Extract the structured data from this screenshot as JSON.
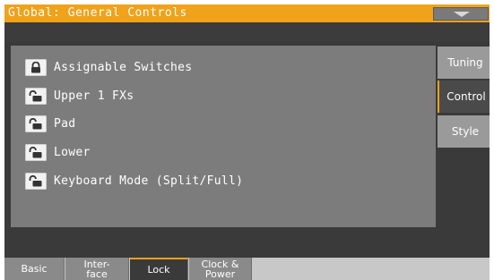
{
  "header": {
    "title": "Global: General Controls",
    "menu_icon": "chevron-down-icon"
  },
  "lock_items": [
    {
      "label": "Assignable Switches",
      "locked": true
    },
    {
      "label": "Upper 1 FXs",
      "locked": false
    },
    {
      "label": "Pad",
      "locked": false
    },
    {
      "label": "Lower",
      "locked": false
    },
    {
      "label": "Keyboard Mode (Split/Full)",
      "locked": false
    }
  ],
  "side_tabs": [
    {
      "label": "Tuning",
      "active": false
    },
    {
      "label": "Control",
      "active": true
    },
    {
      "label": "Style",
      "active": false
    }
  ],
  "bottom_tabs": [
    {
      "label": "Basic",
      "active": false
    },
    {
      "label": "Inter-\nface",
      "active": false
    },
    {
      "label": "Lock",
      "active": true
    },
    {
      "label": "Clock &\nPower",
      "active": false
    }
  ],
  "colors": {
    "accent": "#f0a21a",
    "panel": "#7c7c7c",
    "background": "#3a3a3a"
  }
}
